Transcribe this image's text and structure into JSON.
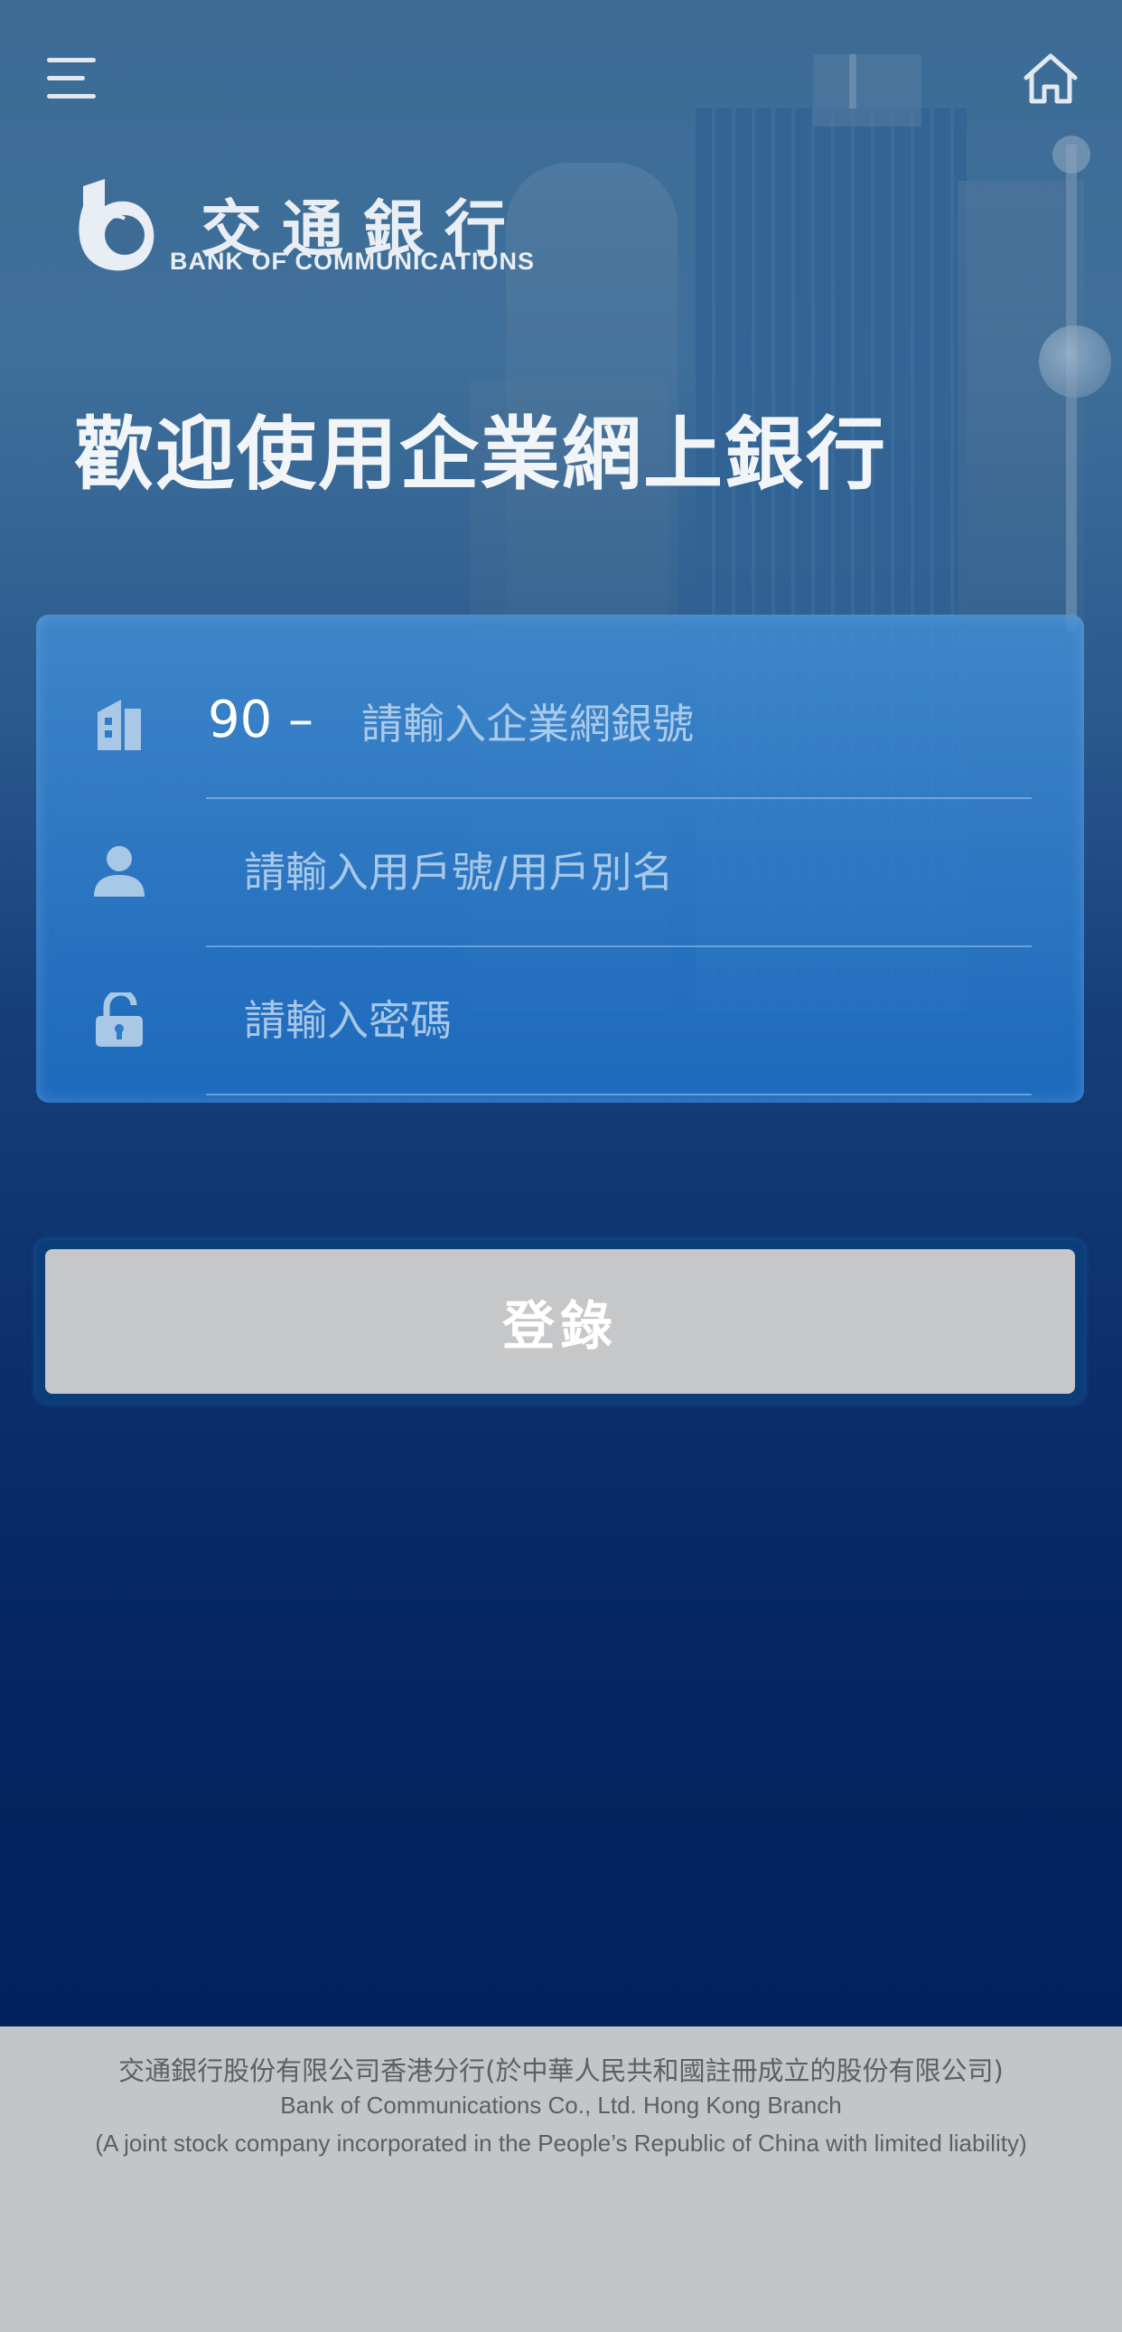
{
  "header": {
    "menu_icon": "hamburger-menu-icon",
    "home_icon": "home-icon"
  },
  "logo": {
    "icon": "bank-logo-icon",
    "name_cn": "交通銀行",
    "name_en": "BANK OF COMMUNICATIONS"
  },
  "welcome_title": "歡迎使用企業網上銀行",
  "form": {
    "company": {
      "icon": "building-icon",
      "prefix": "90 –",
      "value": "",
      "placeholder": "請輸入企業網銀號"
    },
    "user": {
      "icon": "user-icon",
      "value": "",
      "placeholder": "請輸入用戶號/用戶別名"
    },
    "password": {
      "icon": "lock-icon",
      "value": "",
      "placeholder": "請輸入密碼"
    },
    "login_label": "登錄"
  },
  "footer": {
    "line1": "交通銀行股份有限公司香港分行(於中華人民共和國註冊成立的股份有限公司)",
    "line2": "Bank of Communications Co., Ltd. Hong Kong Branch",
    "line3": "(A joint stock company incorporated in the People’s Republic of China with limited liability)"
  },
  "colors": {
    "card": "#2f7cc8",
    "button": "#c5c7c8",
    "footer_bg": "#c2c6c9"
  }
}
